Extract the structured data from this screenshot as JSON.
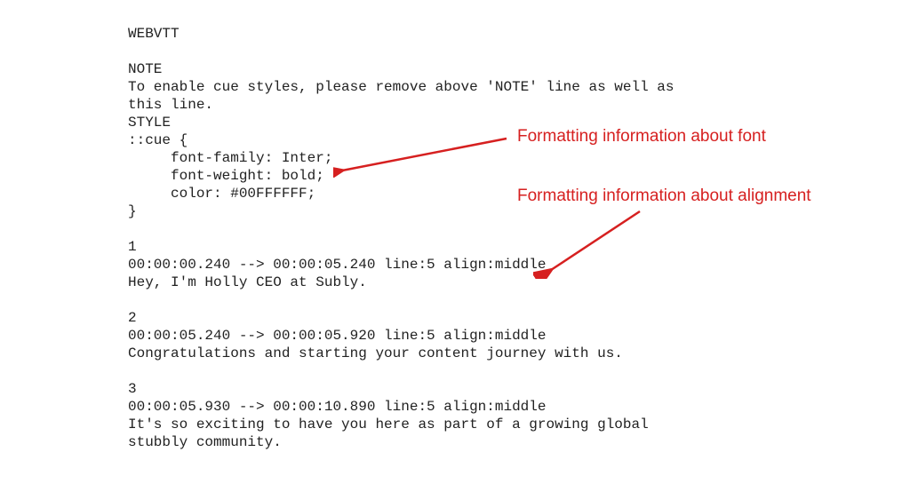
{
  "code": {
    "line01": "WEBVTT",
    "line02": "",
    "line03": "NOTE",
    "line04": "To enable cue styles, please remove above 'NOTE' line as well as",
    "line05": "this line.",
    "line06": "STYLE",
    "line07": "::cue {",
    "line08": "     font-family: Inter;",
    "line09": "     font-weight: bold;",
    "line10": "     color: #00FFFFFF;",
    "line11": "}",
    "line12": "",
    "line13": "1",
    "line14": "00:00:00.240 --> 00:00:05.240 line:5 align:middle",
    "line15": "Hey, I'm Holly CEO at Subly.",
    "line16": "",
    "line17": "2",
    "line18": "00:00:05.240 --> 00:00:05.920 line:5 align:middle",
    "line19": "Congratulations and starting your content journey with us.",
    "line20": "",
    "line21": "3",
    "line22": "00:00:05.930 --> 00:00:10.890 line:5 align:middle",
    "line23": "It's so exciting to have you here as part of a growing global",
    "line24": "stubbly community."
  },
  "annotations": {
    "font_label": "Formatting information about font",
    "alignment_label": "Formatting information about alignment"
  }
}
